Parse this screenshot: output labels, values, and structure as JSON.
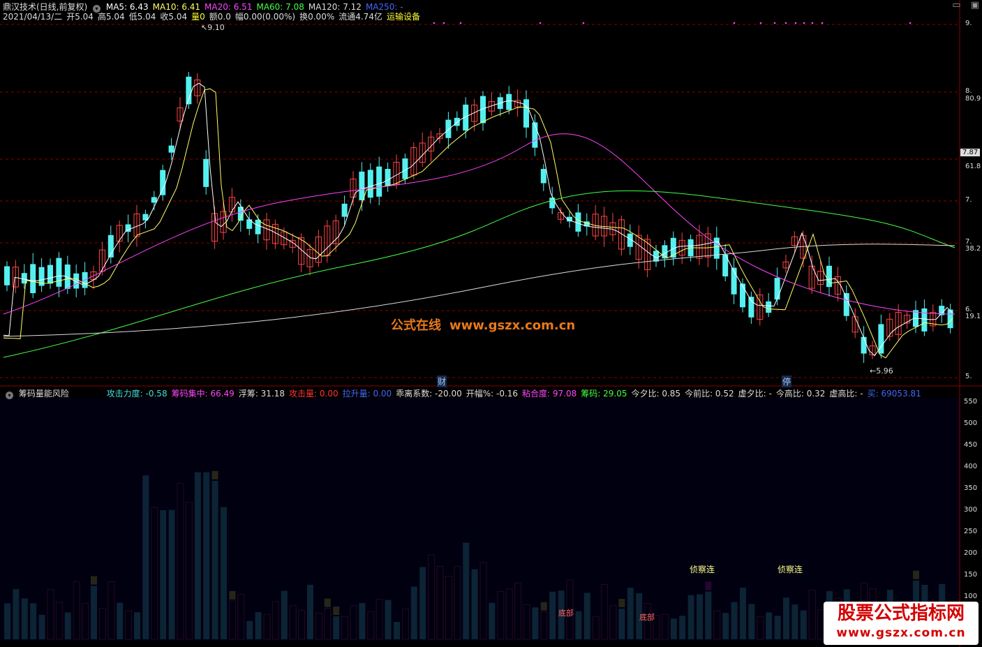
{
  "header": {
    "app_title": "鼎汉技术(日线,前复权)",
    "ma": [
      {
        "label": "MA5: 6.43",
        "color": "#ffffff"
      },
      {
        "label": "MA10: 6.41",
        "color": "#ffff66"
      },
      {
        "label": "MA20: 6.51",
        "color": "#ff44ff"
      },
      {
        "label": "MA60: 7.08",
        "color": "#44ff44"
      },
      {
        "label": "MA120: 7.12",
        "color": "#dddddd"
      },
      {
        "label": "MA250: -",
        "color": "#4466ff"
      }
    ],
    "quote": [
      {
        "label": "2021/04/13/二",
        "color": "#dddddd"
      },
      {
        "label": "开5.04",
        "color": "#dddddd"
      },
      {
        "label": "高5.04",
        "color": "#dddddd"
      },
      {
        "label": "低5.04",
        "color": "#dddddd"
      },
      {
        "label": "收5.04",
        "color": "#dddddd"
      },
      {
        "label": "量0",
        "color": "#ffff33"
      },
      {
        "label": "额0.0",
        "color": "#dddddd"
      },
      {
        "label": "幅0.00(0.00%)",
        "color": "#dddddd"
      },
      {
        "label": "换0.00%",
        "color": "#dddddd"
      },
      {
        "label": "流通4.74亿",
        "color": "#dddddd"
      },
      {
        "label": "运输设备",
        "color": "#ffff33"
      }
    ]
  },
  "main_chart": {
    "high_label": "9.10",
    "low_label": "5.96",
    "price_axis": [
      "9.",
      "8.",
      "80.9",
      "7.87",
      "61.8",
      "7.",
      "7.",
      "38.2",
      "6.",
      "19.1",
      "5."
    ],
    "markers": [
      "财",
      "停"
    ],
    "watermark_cn": "公式在线",
    "watermark_url": "www.gszx.com.cn"
  },
  "indicator": {
    "title": "筹码量能风险",
    "values": [
      {
        "label": "攻击力度: -0.58",
        "color": "#44dddd"
      },
      {
        "label": "筹码集中: 66.49",
        "color": "#ff44ff"
      },
      {
        "label": "浮筹: 31.18",
        "color": "#dddddd"
      },
      {
        "label": "攻击量: 0.00",
        "color": "#ff3333"
      },
      {
        "label": "拉升量: 0.00",
        "color": "#4466ff"
      },
      {
        "label": "乖离系数: -20.00",
        "color": "#dddddd"
      },
      {
        "label": "开幅%: -0.16",
        "color": "#dddddd"
      },
      {
        "label": "粘合度: 97.08",
        "color": "#ff44ff"
      },
      {
        "label": "筹码: 29.05",
        "color": "#44ff44"
      },
      {
        "label": "今夕比: 0.85",
        "color": "#dddddd"
      },
      {
        "label": "今前比: 0.52",
        "color": "#dddddd"
      },
      {
        "label": "虚夕比: -",
        "color": "#dddddd"
      },
      {
        "label": "今高比: 0.32",
        "color": "#dddddd"
      },
      {
        "label": "虚高比: -",
        "color": "#dddddd"
      },
      {
        "label": "买: 69053.81",
        "color": "#4466ff"
      }
    ],
    "axis": [
      "550",
      "500",
      "450",
      "400",
      "350",
      "300",
      "250",
      "200",
      "150",
      "100"
    ],
    "annotations": [
      "侦察连",
      "侦察连",
      "底部",
      "底部"
    ]
  },
  "brand": {
    "line1": "股票公式指标网",
    "line2": "www.gszx.com.cn"
  }
}
